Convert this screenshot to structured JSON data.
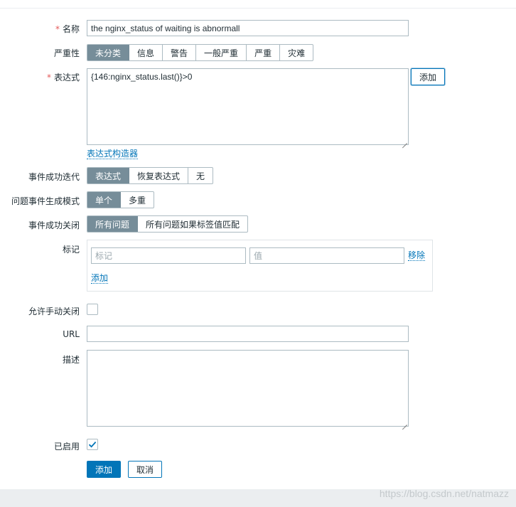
{
  "form": {
    "name_label": "名称",
    "name_value": "the nginx_status of waiting is abnormall",
    "severity_label": "严重性",
    "severity_options": [
      "未分类",
      "信息",
      "警告",
      "一般严重",
      "严重",
      "灾难"
    ],
    "severity_selected": "未分类",
    "expression_label": "表达式",
    "expression_value": "{146:nginx_status.last()}>0",
    "expression_add_button": "添加",
    "expression_builder_link": "表达式构造器",
    "ok_event_label": "事件成功迭代",
    "ok_event_options": [
      "表达式",
      "恢复表达式",
      "无"
    ],
    "ok_event_selected": "表达式",
    "problem_mode_label": "问题事件生成模式",
    "problem_mode_options": [
      "单个",
      "多重"
    ],
    "problem_mode_selected": "单个",
    "ok_close_label": "事件成功关闭",
    "ok_close_options": [
      "所有问题",
      "所有问题如果标签值匹配"
    ],
    "ok_close_selected": "所有问题",
    "tags_label": "标记",
    "tag_name_placeholder": "标记",
    "tag_value_placeholder": "值",
    "tag_remove_link": "移除",
    "tag_add_link": "添加",
    "manual_close_label": "允许手动关闭",
    "manual_close_checked": false,
    "url_label": "URL",
    "url_value": "",
    "description_label": "描述",
    "description_value": "",
    "enabled_label": "已启用",
    "enabled_checked": true,
    "submit_button": "添加",
    "cancel_button": "取消"
  },
  "watermark": "https://blog.csdn.net/natmazz",
  "colors": {
    "accent": "#0275b8",
    "segment_selected": "#768d99",
    "required": "#e45959",
    "border": "#acbbc2"
  }
}
